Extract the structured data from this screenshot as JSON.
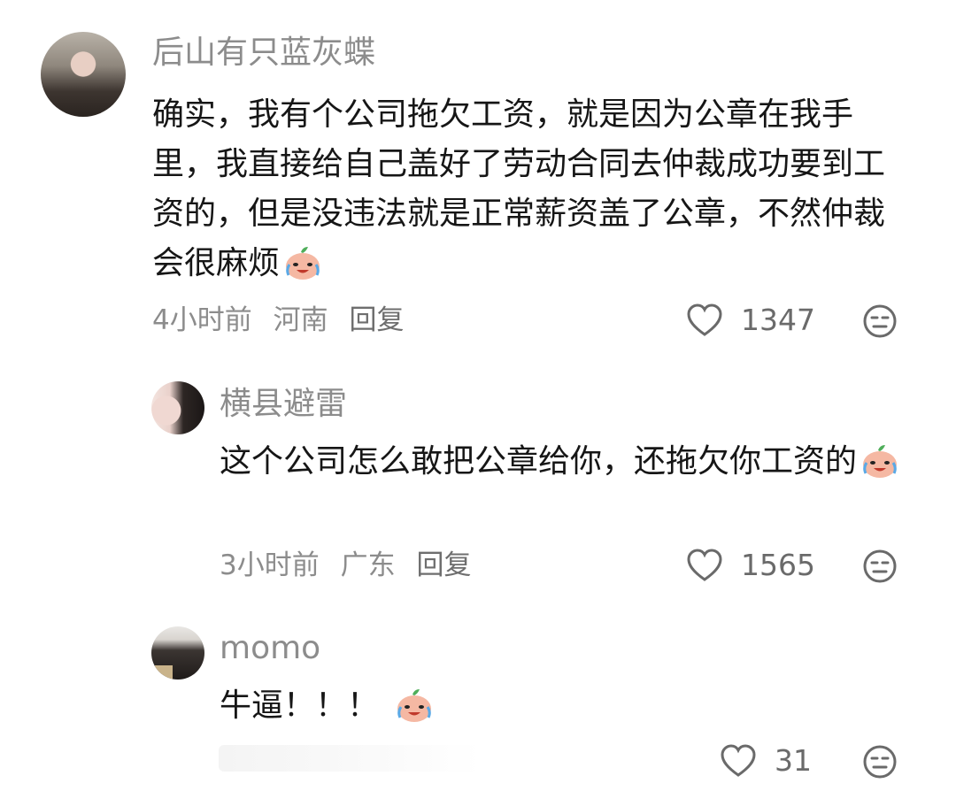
{
  "comments": [
    {
      "username": "后山有只蓝灰蝶",
      "text": "确实，我有个公司拖欠工资，就是因为公章在我手里，我直接给自己盖好了劳动合同去仲裁成功要到工资的，但是没违法就是正常薪资盖了公章，不然仲裁会很麻烦",
      "emoji": "crying-laughing-peach",
      "time": "4小时前",
      "location": "河南",
      "reply_label": "回复",
      "likes": "1347"
    },
    {
      "username": "横县避雷",
      "text": "这个公司怎么敢把公章给你，还拖欠你工资的",
      "emoji": "crying-laughing-peach",
      "time": "3小时前",
      "location": "广东",
      "reply_label": "回复",
      "likes": "1565"
    },
    {
      "username": "momo",
      "text": "牛逼！！！",
      "emoji": "crying-laughing-peach",
      "likes": "31"
    }
  ],
  "icons": {
    "like": "heart-outline-icon",
    "dislike": "meh-face-icon"
  },
  "colors": {
    "username": "#8c8c8c",
    "text": "#161616",
    "meta": "#8c8c8c"
  }
}
